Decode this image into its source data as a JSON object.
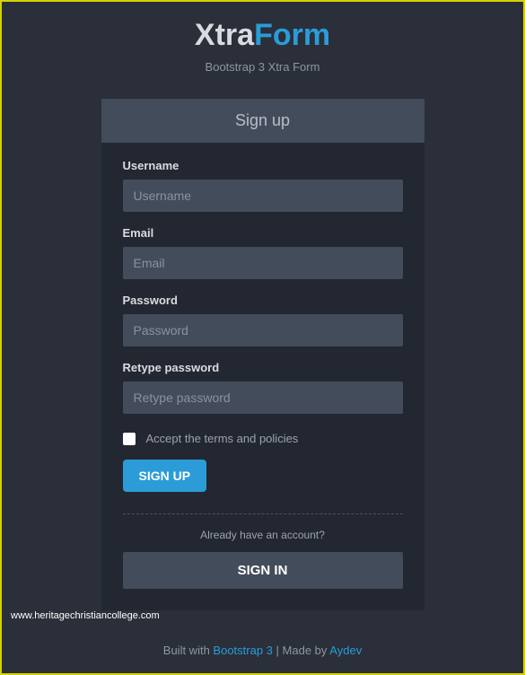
{
  "logo": {
    "part1": "Xtra",
    "part2": "Form"
  },
  "subtitle": "Bootstrap 3 Xtra Form",
  "form": {
    "header": "Sign up",
    "username": {
      "label": "Username",
      "placeholder": "Username"
    },
    "email": {
      "label": "Email",
      "placeholder": "Email"
    },
    "password": {
      "label": "Password",
      "placeholder": "Password"
    },
    "retype": {
      "label": "Retype password",
      "placeholder": "Retype password"
    },
    "terms": "Accept the terms and policies",
    "signup_btn": "SIGN UP",
    "already": "Already have an account?",
    "signin_btn": "SIGN IN"
  },
  "watermark": "www.heritagechristiancollege.com",
  "footer": {
    "built_with": "Built with ",
    "bootstrap": "Bootstrap 3",
    "separator": " | ",
    "made_by": "Made by ",
    "author": "Aydev"
  }
}
